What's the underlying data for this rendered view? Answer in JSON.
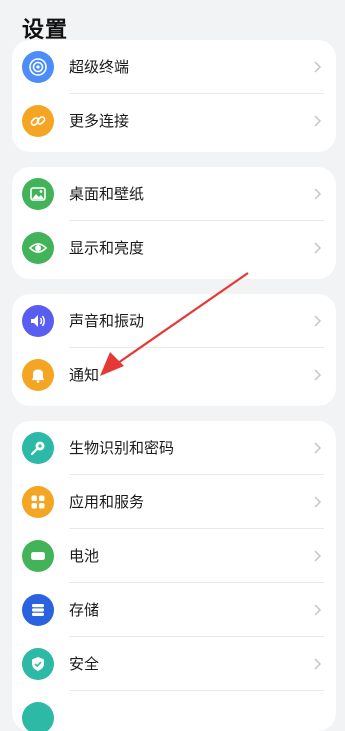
{
  "header": {
    "title": "设置"
  },
  "groups": [
    {
      "items": [
        {
          "label": "超级终端",
          "icon": "super-device-icon",
          "color": "#4c8dfa"
        },
        {
          "label": "更多连接",
          "icon": "link-icon",
          "color": "#f5a524"
        }
      ]
    },
    {
      "items": [
        {
          "label": "桌面和壁纸",
          "icon": "wallpaper-icon",
          "color": "#43b35a"
        },
        {
          "label": "显示和亮度",
          "icon": "eye-icon",
          "color": "#43b35a"
        }
      ]
    },
    {
      "items": [
        {
          "label": "声音和振动",
          "icon": "speaker-icon",
          "color": "#5a5ef0"
        },
        {
          "label": "通知",
          "icon": "bell-icon",
          "color": "#f5a524"
        }
      ]
    },
    {
      "items": [
        {
          "label": "生物识别和密码",
          "icon": "key-icon",
          "color": "#2cb9a5"
        },
        {
          "label": "应用和服务",
          "icon": "apps-icon",
          "color": "#f5a524"
        },
        {
          "label": "电池",
          "icon": "battery-icon",
          "color": "#43b35a"
        },
        {
          "label": "存储",
          "icon": "storage-icon",
          "color": "#2a62e0"
        },
        {
          "label": "安全",
          "icon": "shield-icon",
          "color": "#2cb9a5"
        }
      ]
    }
  ],
  "annotation": {
    "type": "red-arrow",
    "points_to": "通知",
    "color": "#e53935"
  }
}
